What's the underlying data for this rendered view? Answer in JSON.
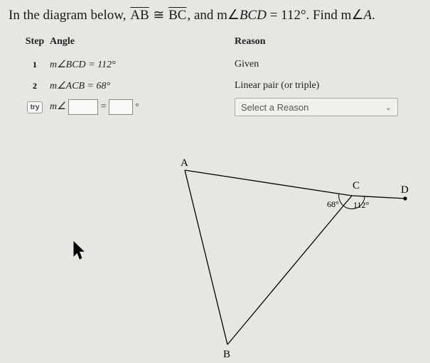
{
  "problem": {
    "prefix": "In the diagram below, ",
    "seg1": "AB",
    "cong": " ≅ ",
    "seg2": "BC",
    "mid": ", and m∠",
    "ang": "BCD",
    "eqv": " = 112°. Find m∠",
    "find": "A",
    "end": "."
  },
  "headers": {
    "step": "Step",
    "angle": "Angle",
    "reason": "Reason"
  },
  "rows": [
    {
      "step": "1",
      "angle": "m∠BCD = 112°",
      "reason": "Given"
    },
    {
      "step": "2",
      "angle": "m∠ACB = 68°",
      "reason": "Linear pair (or triple)"
    }
  ],
  "tryRow": {
    "btn": "try",
    "prefix": "m∠",
    "eq": " = ",
    "degmark": "°",
    "reasonPlaceholder": "Select a Reason"
  },
  "diagram": {
    "A": "A",
    "B": "B",
    "C": "C",
    "D": "D",
    "angACB": "68°",
    "angBCD": "112°"
  },
  "chart_data": {
    "type": "diagram",
    "given": {
      "AB_congruent_BC": true,
      "m_BCD_deg": 112
    },
    "derived": {
      "m_ACB_deg": 68
    },
    "unknown": "m_A_deg",
    "points": [
      "A",
      "B",
      "C",
      "D"
    ]
  }
}
